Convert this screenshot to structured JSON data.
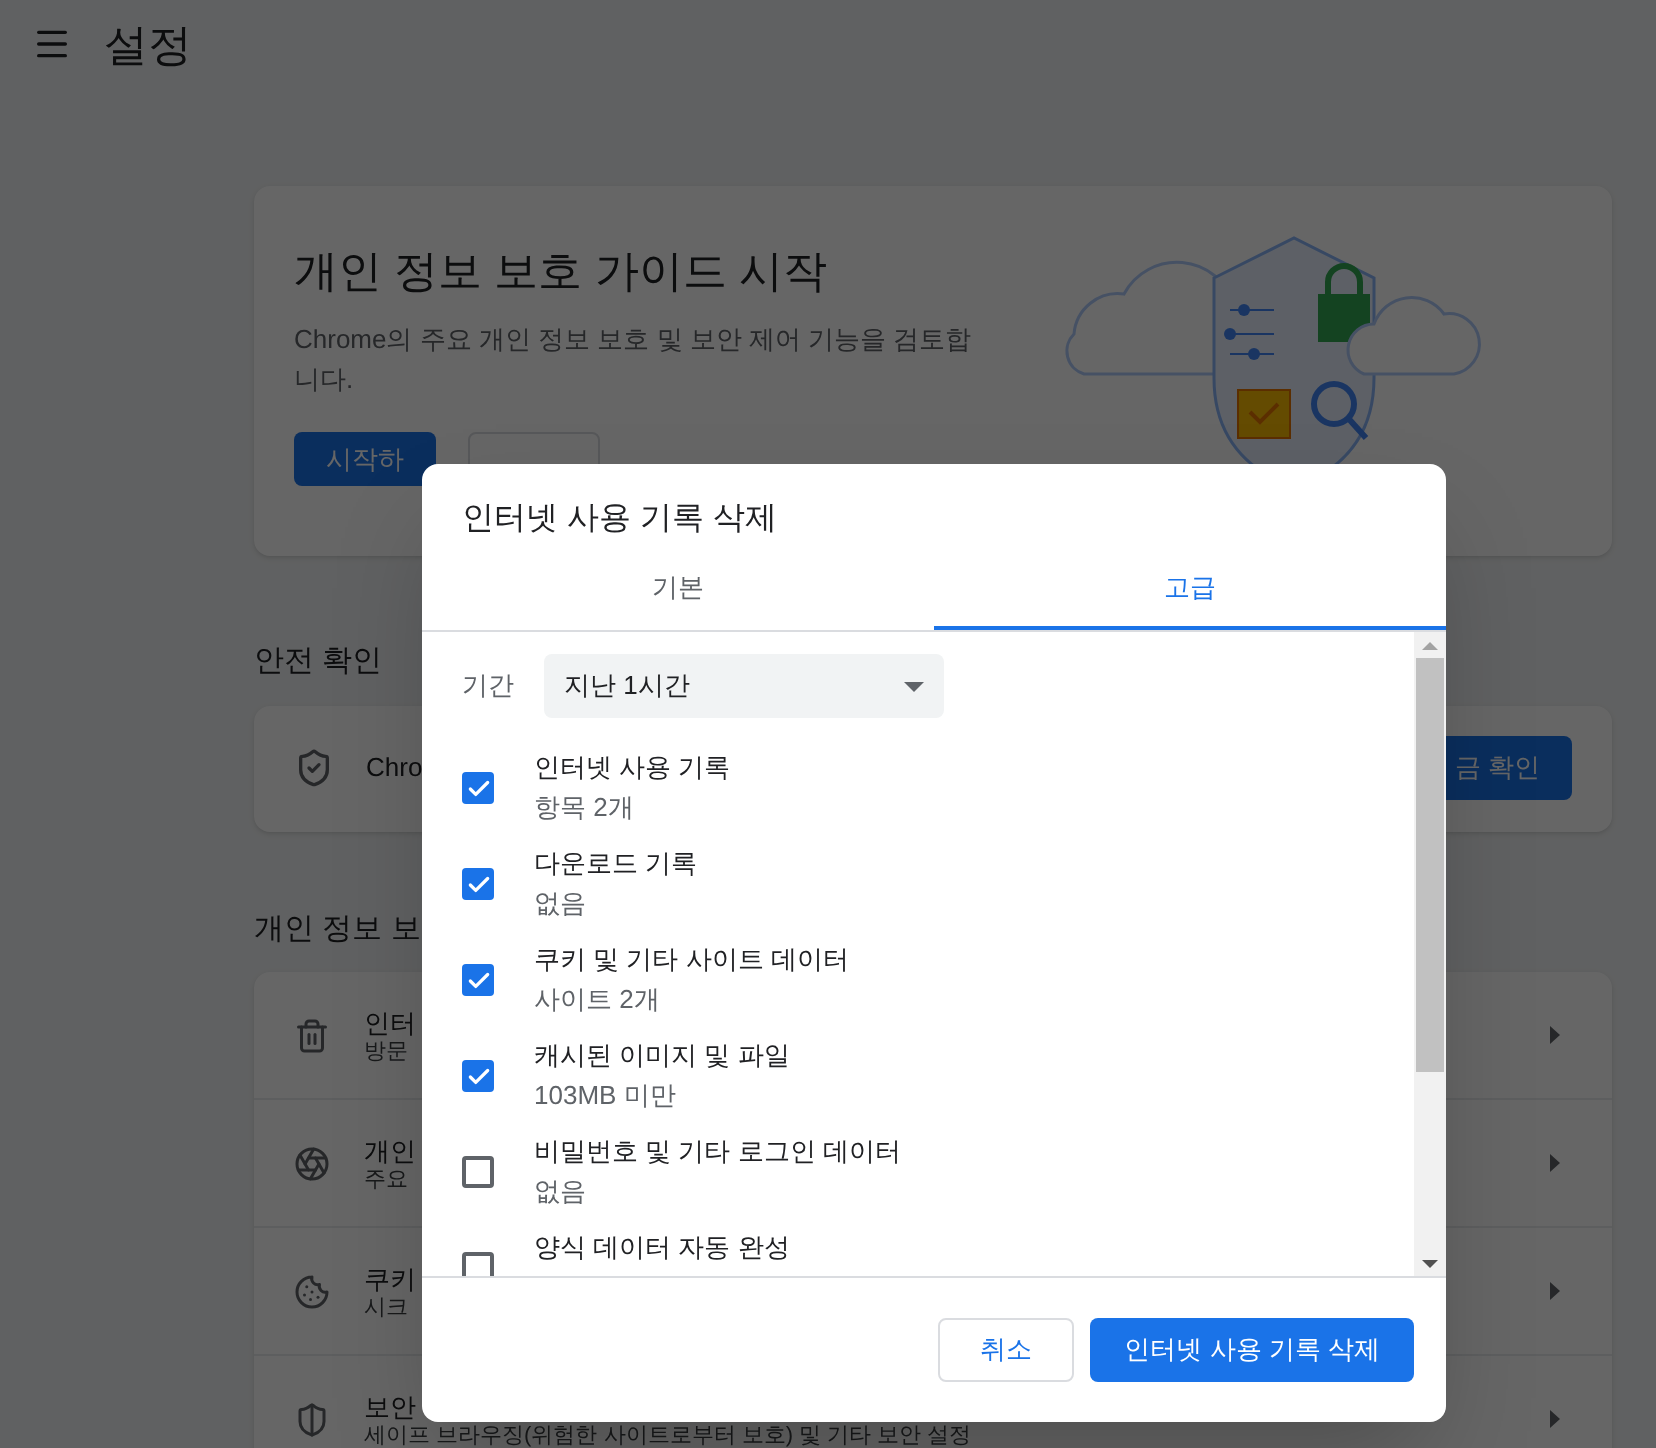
{
  "header": {
    "title": "설정"
  },
  "privacy_guide": {
    "title": "개인 정보 보호 가이드 시작",
    "description": "Chrome의 주요 개인 정보 보호 및 보안 제어 기능을 검토합니다.",
    "buttons": [
      "시작하"
    ]
  },
  "safety_check": {
    "heading": "안전 확인",
    "text": "Chro",
    "button": "금 확인"
  },
  "privacy_section": {
    "heading": "개인 정보 보",
    "rows": [
      {
        "title": "인터",
        "subtitle": "방문"
      },
      {
        "title": "개인",
        "subtitle": "주요"
      },
      {
        "title": "쿠키",
        "subtitle": "시크"
      },
      {
        "title": "보안",
        "subtitle": "세이프 브라우징(위험한 사이트로부터 보호) 및 기타 보안 설정"
      }
    ]
  },
  "dialog": {
    "title": "인터넷 사용 기록 삭제",
    "tabs": [
      {
        "label": "기본",
        "selected": false
      },
      {
        "label": "고급",
        "selected": true
      }
    ],
    "period": {
      "label": "기간",
      "value": "지난 1시간"
    },
    "items": [
      {
        "label": "인터넷 사용 기록",
        "detail": "항목 2개",
        "checked": true
      },
      {
        "label": "다운로드 기록",
        "detail": "없음",
        "checked": true
      },
      {
        "label": "쿠키 및 기타 사이트 데이터",
        "detail": "사이트 2개",
        "checked": true
      },
      {
        "label": "캐시된 이미지 및 파일",
        "detail": "103MB 미만",
        "checked": true
      },
      {
        "label": "비밀번호 및 기타 로그인 데이터",
        "detail": "없음",
        "checked": false
      },
      {
        "label": "양식 데이터 자동 완성",
        "checked": false
      }
    ],
    "buttons": [
      {
        "label": "취소",
        "kind": "secondary"
      },
      {
        "label": "인터넷 사용 기록 삭제",
        "kind": "primary"
      }
    ]
  }
}
